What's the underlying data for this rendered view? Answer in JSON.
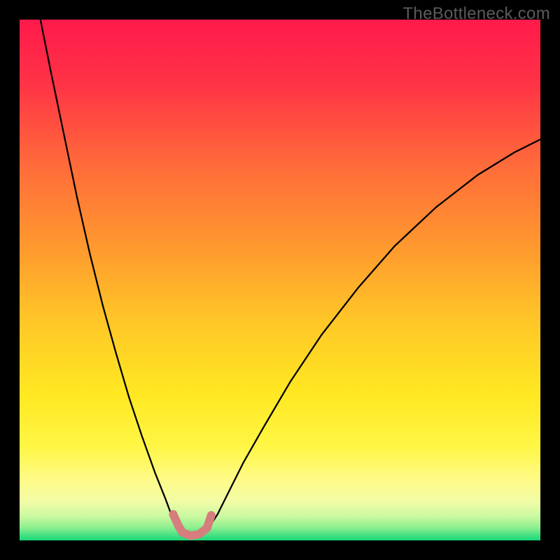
{
  "watermark": "TheBottleneck.com",
  "chart_data": {
    "type": "line",
    "title": "",
    "xlabel": "",
    "ylabel": "",
    "xlim": [
      0,
      100
    ],
    "ylim": [
      0,
      100
    ],
    "grid": false,
    "legend": false,
    "background_gradient_stops": [
      {
        "offset": 0.0,
        "color": "#ff1a4b"
      },
      {
        "offset": 0.12,
        "color": "#ff3246"
      },
      {
        "offset": 0.28,
        "color": "#ff6b3a"
      },
      {
        "offset": 0.44,
        "color": "#ff9a2e"
      },
      {
        "offset": 0.58,
        "color": "#ffc727"
      },
      {
        "offset": 0.72,
        "color": "#ffe822"
      },
      {
        "offset": 0.82,
        "color": "#fff645"
      },
      {
        "offset": 0.885,
        "color": "#fffb89"
      },
      {
        "offset": 0.925,
        "color": "#f2fca6"
      },
      {
        "offset": 0.955,
        "color": "#c7f8a0"
      },
      {
        "offset": 0.975,
        "color": "#8ef08f"
      },
      {
        "offset": 0.99,
        "color": "#46e184"
      },
      {
        "offset": 1.0,
        "color": "#17d977"
      }
    ],
    "series": [
      {
        "name": "left-branch",
        "stroke": "#000000",
        "stroke_width": 2.3,
        "x": [
          4.0,
          6.0,
          8.5,
          11.0,
          13.5,
          16.0,
          18.5,
          21.0,
          23.5,
          26.0,
          28.0,
          29.3,
          30.2
        ],
        "y": [
          100.0,
          90.0,
          78.0,
          66.0,
          55.0,
          45.0,
          36.0,
          27.5,
          20.0,
          13.0,
          8.0,
          4.5,
          2.7
        ]
      },
      {
        "name": "right-branch",
        "stroke": "#000000",
        "stroke_width": 2.3,
        "x": [
          36.5,
          38.0,
          40.0,
          43.0,
          47.0,
          52.0,
          58.0,
          65.0,
          72.0,
          80.0,
          88.0,
          95.0,
          100.0
        ],
        "y": [
          2.7,
          5.0,
          9.0,
          15.0,
          22.0,
          30.5,
          39.5,
          48.5,
          56.5,
          64.0,
          70.2,
          74.5,
          77.0
        ]
      },
      {
        "name": "green-band-overlay",
        "stroke": "#d67d7d",
        "stroke_width": 12,
        "linecap": "round",
        "x": [
          29.5,
          30.5,
          31.3,
          32.8,
          34.5,
          36.0,
          36.8
        ],
        "y": [
          5.0,
          2.8,
          1.5,
          0.9,
          1.2,
          2.4,
          4.8
        ]
      }
    ],
    "points": [
      {
        "x": 29.5,
        "y": 5.0,
        "r": 6,
        "fill": "#d67d7d"
      },
      {
        "x": 36.8,
        "y": 4.8,
        "r": 6,
        "fill": "#d67d7d"
      },
      {
        "x": 30.6,
        "y": 2.5,
        "r": 5,
        "fill": "#d67d7d"
      },
      {
        "x": 35.8,
        "y": 2.3,
        "r": 5,
        "fill": "#d67d7d"
      }
    ]
  }
}
